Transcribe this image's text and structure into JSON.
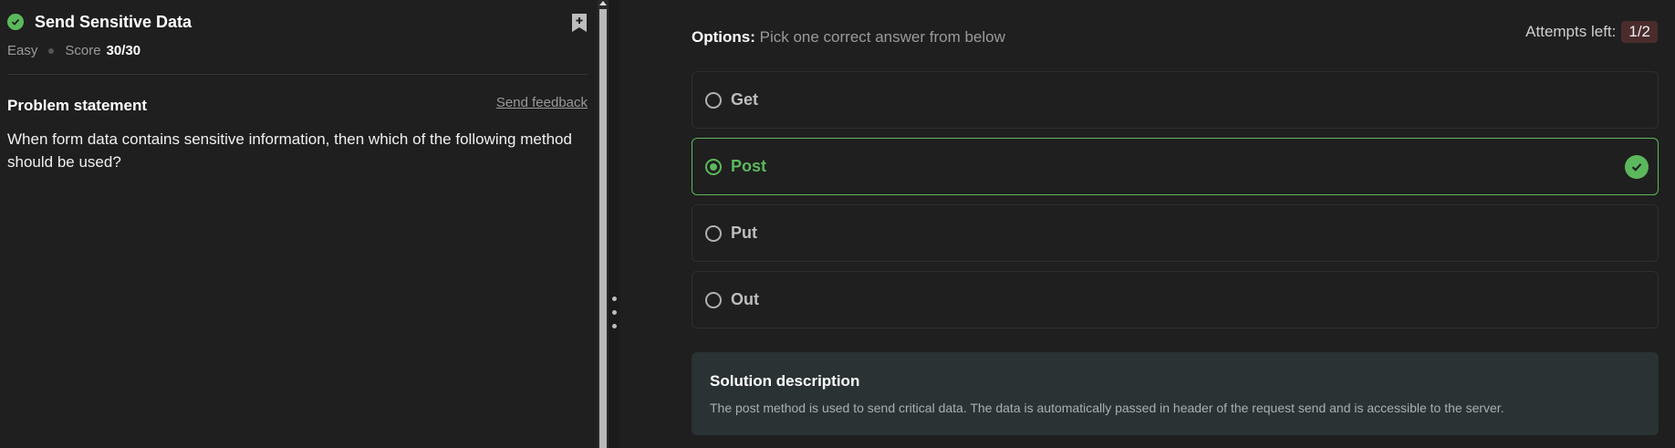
{
  "problem": {
    "title": "Send Sensitive Data",
    "difficulty": "Easy",
    "score_label": "Score",
    "score_value": "30/30",
    "statement_heading": "Problem statement",
    "feedback_link": "Send feedback",
    "statement_text": "When form data contains sensitive information, then which of the following method should be used?"
  },
  "options_section": {
    "label_bold": "Options:",
    "label_rest": " Pick one correct answer from below",
    "attempts_label": "Attempts left:",
    "attempts_value": "1/2",
    "options": [
      {
        "label": "Get",
        "selected": false
      },
      {
        "label": "Post",
        "selected": true,
        "correct": true
      },
      {
        "label": "Put",
        "selected": false
      },
      {
        "label": "Out",
        "selected": false
      }
    ]
  },
  "solution": {
    "title": "Solution description",
    "text": "The post method is used to send critical data. The data is automatically passed in header of the request send and is accessible to the server."
  },
  "colors": {
    "success": "#5cb85c",
    "background": "#1f1f1f",
    "attempts_badge": "#4a2c2c",
    "solution_bg": "#2a3233"
  },
  "icons": {
    "status": "check-circle-icon",
    "bookmark": "bookmark-plus-icon",
    "correct": "check-circle-icon",
    "splitter": "drag-handle-icon"
  }
}
